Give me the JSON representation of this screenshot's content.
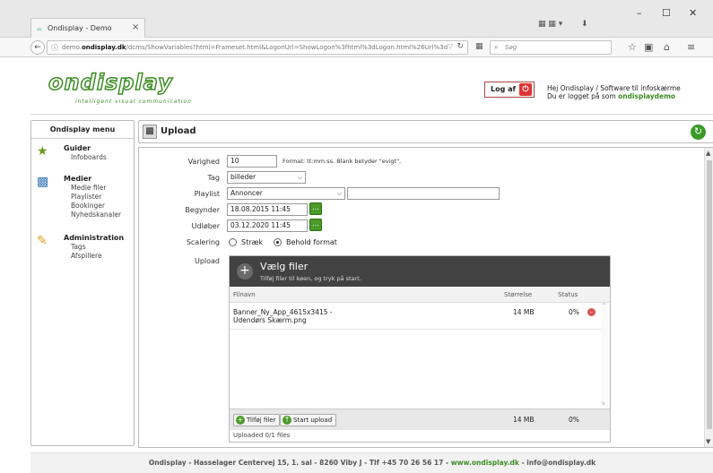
{
  "browser": {
    "tab_title": "Ondisplay - Demo",
    "tab_close": "×",
    "url_prefix": "demo.",
    "url_domain": "ondisplay.dk",
    "url_path": "/dcms/ShowVariables?html=Frameset.html&LogonUrl=ShowLogon%3fhtml%3dLogon.html%26Url%3d%252",
    "search_placeholder": "Søg",
    "window_minimize": "–",
    "window_maximize": "☐",
    "window_close": "✕"
  },
  "header": {
    "logo_word": "ondisplay",
    "logo_tagline": "intelligent visual communication",
    "logout_label": "Log af",
    "greeting_line1": "Hej Ondisplay /  Software til infoskærme",
    "greeting_line2_prefix": "Du er logget på som ",
    "greeting_user": "ondisplaydemo"
  },
  "sidebar": {
    "title": "Ondisplay menu",
    "groups": [
      {
        "title": "Guider",
        "items": [
          "Infoboards"
        ]
      },
      {
        "title": "Medier",
        "items": [
          "Medie filer",
          "Playlister",
          "Bookinger",
          "Nyhedskanaler"
        ]
      },
      {
        "title": "Administration",
        "items": [
          "Tags",
          "Afspillere"
        ]
      }
    ]
  },
  "main": {
    "title": "Upload",
    "form": {
      "varighed_label": "Varighed",
      "varighed_value": "10",
      "varighed_hint": "Format: tt:mm:ss. Blank betyder \"evigt\".",
      "tag_label": "Tag",
      "tag_value": "billeder",
      "playlist_label": "Playlist",
      "playlist_value": "Annoncer",
      "playlist_extra_value": "",
      "begynder_label": "Begynder",
      "begynder_value": "18.08.2015 11:45",
      "udlober_label": "Udløber",
      "udlober_value": "03.12.2020 11:45",
      "cal_button": "...",
      "scalering_label": "Scalering",
      "scalering_options": [
        "Stræk",
        "Behold format"
      ],
      "scalering_selected": "Behold format",
      "upload_label": "Upload"
    },
    "uploader": {
      "title": "Vælg filer",
      "subtitle": "Tilføj filer til køen, og tryk på start.",
      "col_name": "Filnavn",
      "col_size": "Størrelse",
      "col_status": "Status",
      "files": [
        {
          "name": "Banner_Ny_App_4615x3415 - Udendørs Skærm.png",
          "size": "14 MB",
          "percent": "0%"
        }
      ],
      "add_button": "Tilføj filer",
      "start_button": "Start upload",
      "total_size": "14 MB",
      "total_percent": "0%",
      "status_text": "Uploaded 0/1 files"
    }
  },
  "footer": {
    "text": "Ondisplay - Hasselager Centervej 15, 1. sal - 8260 Viby J - Tlf +45 70 26 56 17 - ",
    "website": "www.ondisplay.dk",
    "email": " - info@ondisplay.dk"
  }
}
